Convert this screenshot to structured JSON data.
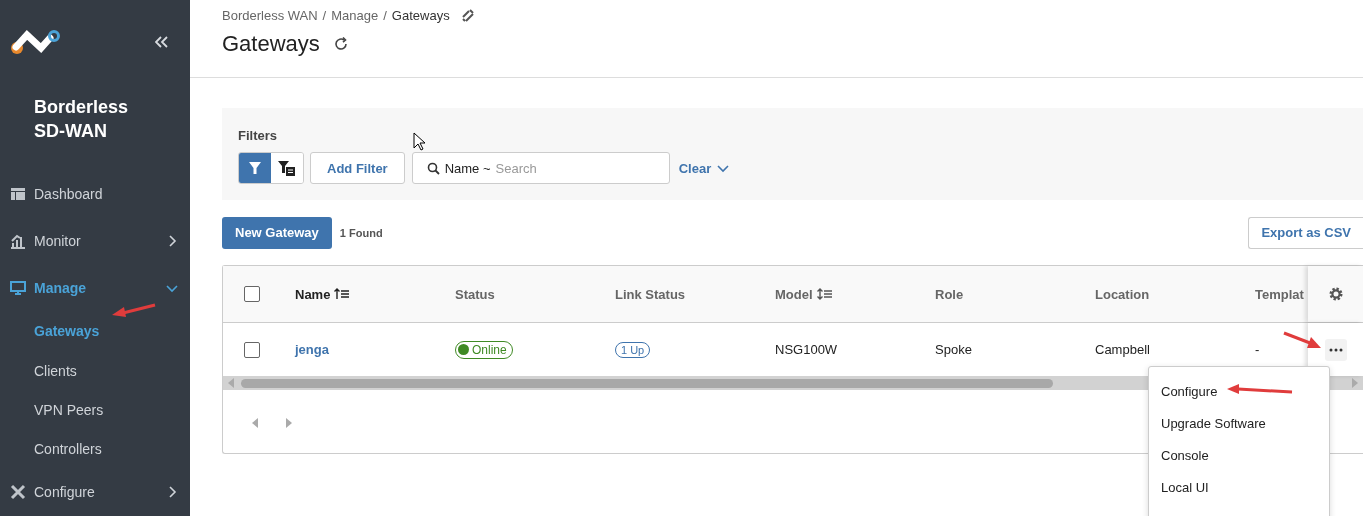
{
  "sidebar": {
    "title": "Borderless SD-WAN",
    "items": [
      {
        "label": "Dashboard",
        "kind": "link",
        "selected": false
      },
      {
        "label": "Monitor",
        "kind": "group",
        "selected": false,
        "expanded": false
      },
      {
        "label": "Manage",
        "kind": "group",
        "selected": true,
        "expanded": true,
        "children": [
          {
            "label": "Gateways",
            "selected": true
          },
          {
            "label": "Clients",
            "selected": false
          },
          {
            "label": "VPN Peers",
            "selected": false
          },
          {
            "label": "Controllers",
            "selected": false
          }
        ]
      },
      {
        "label": "Configure",
        "kind": "group",
        "selected": false,
        "expanded": false
      }
    ]
  },
  "breadcrumb": {
    "items": [
      "Borderless WAN",
      "Manage",
      "Gateways"
    ],
    "separator": "/"
  },
  "page_title": "Gateways",
  "filters": {
    "label": "Filters",
    "view_toggle": [
      {
        "selected": true
      },
      {
        "selected": false
      }
    ],
    "add_button": "Add Filter",
    "search": {
      "prefix": "Name ~",
      "placeholder": "Search"
    },
    "clear_link": "Clear"
  },
  "toolbar": {
    "new_button": "New Gateway",
    "count": "1 Found",
    "export_button": "Export as CSV"
  },
  "table": {
    "select_all": {
      "checked": false
    },
    "columns": [
      {
        "label": "Name",
        "sortable": true,
        "sorted": true
      },
      {
        "label": "Status",
        "sortable": false,
        "sorted": false
      },
      {
        "label": "Link Status",
        "sortable": false,
        "sorted": false
      },
      {
        "label": "Model",
        "sortable": true,
        "sorted": false
      },
      {
        "label": "Role",
        "sortable": false,
        "sorted": false
      },
      {
        "label": "Location",
        "sortable": false,
        "sorted": false
      },
      {
        "label": "Templat",
        "sortable": false,
        "sorted": false
      }
    ],
    "rows": [
      {
        "checked": false,
        "name": "jenga",
        "status": {
          "label": "Online",
          "color": "#3f8a24"
        },
        "link_status": "1 Up",
        "model": "NSG100W",
        "role": "Spoke",
        "location": "Campbell",
        "template": "-"
      }
    ]
  },
  "row_menu": [
    "Configure",
    "Upgrade Software",
    "Console",
    "Local UI"
  ]
}
